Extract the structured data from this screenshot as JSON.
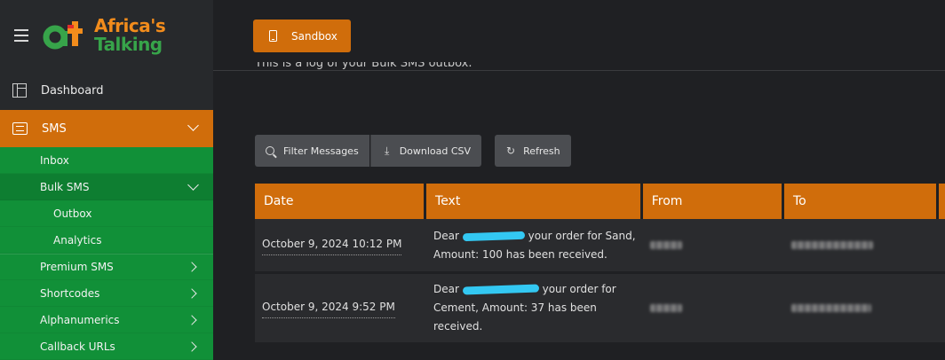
{
  "brand": {
    "line1": "Africa's",
    "line2": "Talking",
    "colors": {
      "orange": "#f28c1c",
      "green": "#37a44a",
      "red": "#e12b2b"
    }
  },
  "sidebar": {
    "dashboard": "Dashboard",
    "sms": "SMS",
    "sms_items": [
      {
        "label": "Inbox"
      },
      {
        "label": "Bulk SMS"
      },
      {
        "label": "Outbox"
      },
      {
        "label": "Analytics"
      },
      {
        "label": "Premium SMS"
      },
      {
        "label": "Shortcodes"
      },
      {
        "label": "Alphanumerics"
      },
      {
        "label": "Callback URLs"
      }
    ]
  },
  "topbar": {
    "sandbox_label": "Sandbox"
  },
  "description": "This is a log of your Bulk SMS outbox.",
  "toolbar": {
    "filter": "Filter Messages",
    "download": "Download CSV",
    "refresh": "Refresh"
  },
  "table": {
    "headers": [
      "Date",
      "Text",
      "From",
      "To"
    ],
    "rows": [
      {
        "date": "October 9, 2024 10:12 PM",
        "text_a": "Dear",
        "text_b": "your order for Sand,",
        "text_c": "Amount: 100 has been received."
      },
      {
        "date": "October 9, 2024 9:52 PM",
        "text_a": "Dear",
        "text_b": "your order for",
        "text_c": "Cement, Amount: 37 has been",
        "text_d": "received."
      }
    ]
  },
  "accent": "#d06d0b",
  "submenu_green": "#119038"
}
